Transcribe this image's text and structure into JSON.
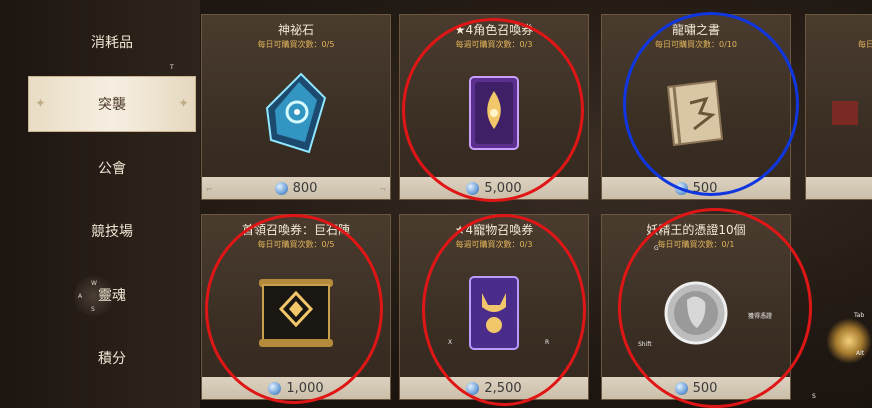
{
  "sidebar": {
    "items": [
      {
        "label": "消耗品"
      },
      {
        "label": "突襲"
      },
      {
        "label": "公會"
      },
      {
        "label": "競技場"
      },
      {
        "label": "靈魂"
      },
      {
        "label": "積分"
      }
    ],
    "active_index": 1,
    "key_hint": "T",
    "compass": {
      "n": "W",
      "w": "A",
      "s": "S"
    }
  },
  "cards": [
    {
      "title": "神祕石",
      "limit": "每日可購買次數：0/5",
      "price": "800",
      "item_icon": "mystic-stone-icon"
    },
    {
      "title": "★4角色召喚券",
      "limit": "每週可購買次數：0/3",
      "price": "5,000",
      "item_icon": "hero-summon-ticket-icon"
    },
    {
      "title": "龍嘯之書",
      "limit": "每日可購買次數：0/10",
      "price": "500",
      "item_icon": "dragon-scroll-icon"
    },
    {
      "title": "",
      "limit": "每日",
      "price": "",
      "item_icon": "book-icon"
    },
    {
      "title": "首領召喚券：巨石陣",
      "limit": "每日可購買次數：0/5",
      "price": "1,000",
      "item_icon": "boss-summon-scroll-icon"
    },
    {
      "title": "★4寵物召喚券",
      "limit": "每週可購買次數：0/3",
      "price": "2,500",
      "item_icon": "pet-summon-ticket-icon"
    },
    {
      "title": "妖精王的憑證10個",
      "limit": "每日可購買次數：0/1",
      "price": "500",
      "item_icon": "fairy-king-coin-icon"
    }
  ],
  "key_hints": {
    "x": "X",
    "r": "R",
    "shift": "Shift",
    "tab": "Tab",
    "alt": "Alt",
    "s": "S",
    "card_label": "獲得憑證",
    "g": "G"
  },
  "colors": {
    "highlight_red": "#e01616",
    "highlight_blue": "#1036e0",
    "limit_text": "#e0b45a"
  }
}
